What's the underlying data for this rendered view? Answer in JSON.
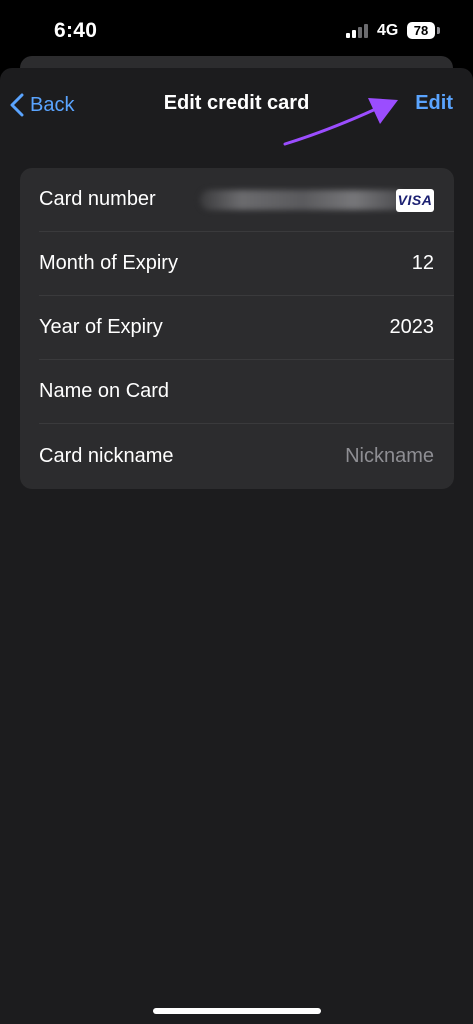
{
  "status_bar": {
    "time": "6:40",
    "network": "4G",
    "battery": "78"
  },
  "nav": {
    "back_label": "Back",
    "title": "Edit credit card",
    "edit_label": "Edit"
  },
  "card_form": {
    "card_number_label": "Card number",
    "card_brand": "VISA",
    "month_label": "Month of Expiry",
    "month_value": "12",
    "year_label": "Year of Expiry",
    "year_value": "2023",
    "name_label": "Name on Card",
    "name_value": "",
    "nickname_label": "Card nickname",
    "nickname_placeholder": "Nickname"
  },
  "colors": {
    "accent": "#5aa4ff",
    "annotation": "#9b4dff",
    "background": "#1c1c1e",
    "group": "#2c2c2e"
  }
}
